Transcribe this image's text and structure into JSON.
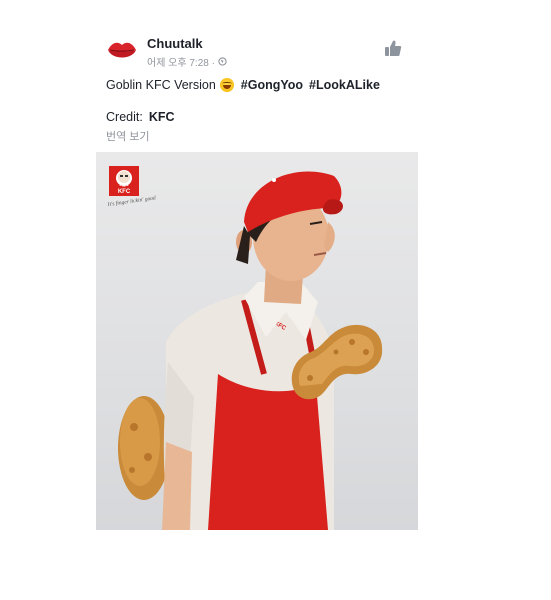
{
  "post": {
    "author": "Chuutalk",
    "timestamp": "어제 오후 7:28 · ",
    "text_prefix": "Goblin KFC Version",
    "hashtags": [
      "#GongYoo",
      "#LookALike"
    ],
    "credit_label": "Credit:",
    "credit_value": "KFC",
    "translate_link": "번역 보기"
  },
  "photo": {
    "logo_text": "KFC",
    "slogan": "It's finger lickin' good",
    "apron_text": "KFC"
  },
  "colors": {
    "text": "#1d2129",
    "muted": "#90949c",
    "kfc_red": "#d9211d"
  },
  "icons": [
    "lips-avatar-icon",
    "globe-icon",
    "thumbs-up-icon",
    "laughing-emoji-icon"
  ]
}
